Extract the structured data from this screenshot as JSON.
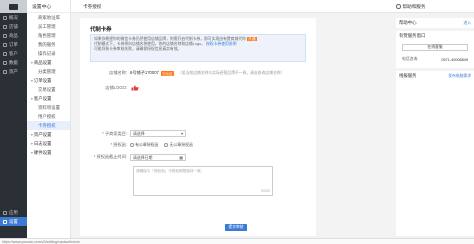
{
  "nav": {
    "items": [
      {
        "label": "概况",
        "icon": "home-icon",
        "active": false
      },
      {
        "label": "店铺",
        "icon": "shop-icon",
        "active": false
      },
      {
        "label": "商品",
        "icon": "goods-icon",
        "active": false
      },
      {
        "label": "订单",
        "icon": "order-icon",
        "active": false
      },
      {
        "label": "客户",
        "icon": "user-icon",
        "active": false
      },
      {
        "label": "数据",
        "icon": "chart-icon",
        "active": false
      },
      {
        "label": "资产",
        "icon": "wallet-icon",
        "active": false
      }
    ],
    "bottom_items": [
      {
        "label": "应用",
        "icon": "apps-icon",
        "active": false
      },
      {
        "label": "设置",
        "icon": "gear-icon",
        "active": true
      }
    ]
  },
  "subnav": {
    "header": "设置中心",
    "entries": [
      {
        "kind": "item",
        "label": "商家地址库"
      },
      {
        "kind": "item",
        "label": "员工管理"
      },
      {
        "kind": "item",
        "label": "角色管理"
      },
      {
        "kind": "item",
        "label": "我的服务"
      },
      {
        "kind": "item",
        "label": "操作记录"
      },
      {
        "kind": "group",
        "label": "商品设置"
      },
      {
        "kind": "item",
        "label": "分类管理"
      },
      {
        "kind": "group",
        "label": "订单设置"
      },
      {
        "kind": "item",
        "label": "交易设置"
      },
      {
        "kind": "group",
        "label": "客户设置"
      },
      {
        "kind": "item",
        "label": "资料项设置"
      },
      {
        "kind": "item",
        "label": "用户授权"
      },
      {
        "kind": "item",
        "label": "卡券授权",
        "active": true
      },
      {
        "kind": "group",
        "label": "资产设置"
      },
      {
        "kind": "group",
        "label": "日志设置"
      },
      {
        "kind": "group",
        "label": "硬件设置"
      }
    ]
  },
  "topbar": {
    "title": "卡券授权",
    "help": "帮助和服务"
  },
  "main": {
    "section_title": "代制卡券",
    "notice_lines": [
      "如果你希望你的微信卡券仍然使用店铺品牌，则需开启代制卡券，即可实现由有赞商城代你",
      "代制模式下，卡券将向店铺名称使用，你的店铺名称和店铺Logo，",
      "可能导致卡券审核失败，请确保授权信息真实有效。"
    ],
    "notice_highlight": "开通",
    "notice_link": "授权卡券使用说明",
    "store_name_label": "店铺名称:",
    "store_name_value": "6号铺子170007",
    "store_tag": "已认证",
    "store_hint": "（若当前店铺名称与实际经营品牌不一致，请去修改店铺名称）",
    "logo_label": "店铺LOGO:",
    "category_label": "子商家类目:",
    "category_value": "请选择",
    "auth_label": "授权函:",
    "auth_options": [
      "有公章授权函",
      "无公章授权函"
    ],
    "expire_label": "授权函截止时间:",
    "expire_placeholder": "请选择日期",
    "desc_text": "请确保与「授权函」中授权期限保持一致。",
    "desc_count": "0/200",
    "submit_label": "提交审核"
  },
  "right": {
    "help_center": "帮助中心",
    "help_link": "进入",
    "service_title": "有赞服务窗口",
    "online_btn": "在线客服",
    "phone_label": "电话咨询:",
    "phone_number": "0571-40008849",
    "news_title": "线报服务",
    "news_link": "发布电脑需求"
  },
  "statusbar": {
    "url": "https://www.youzan.com/v2/setting/cardauthorize"
  }
}
